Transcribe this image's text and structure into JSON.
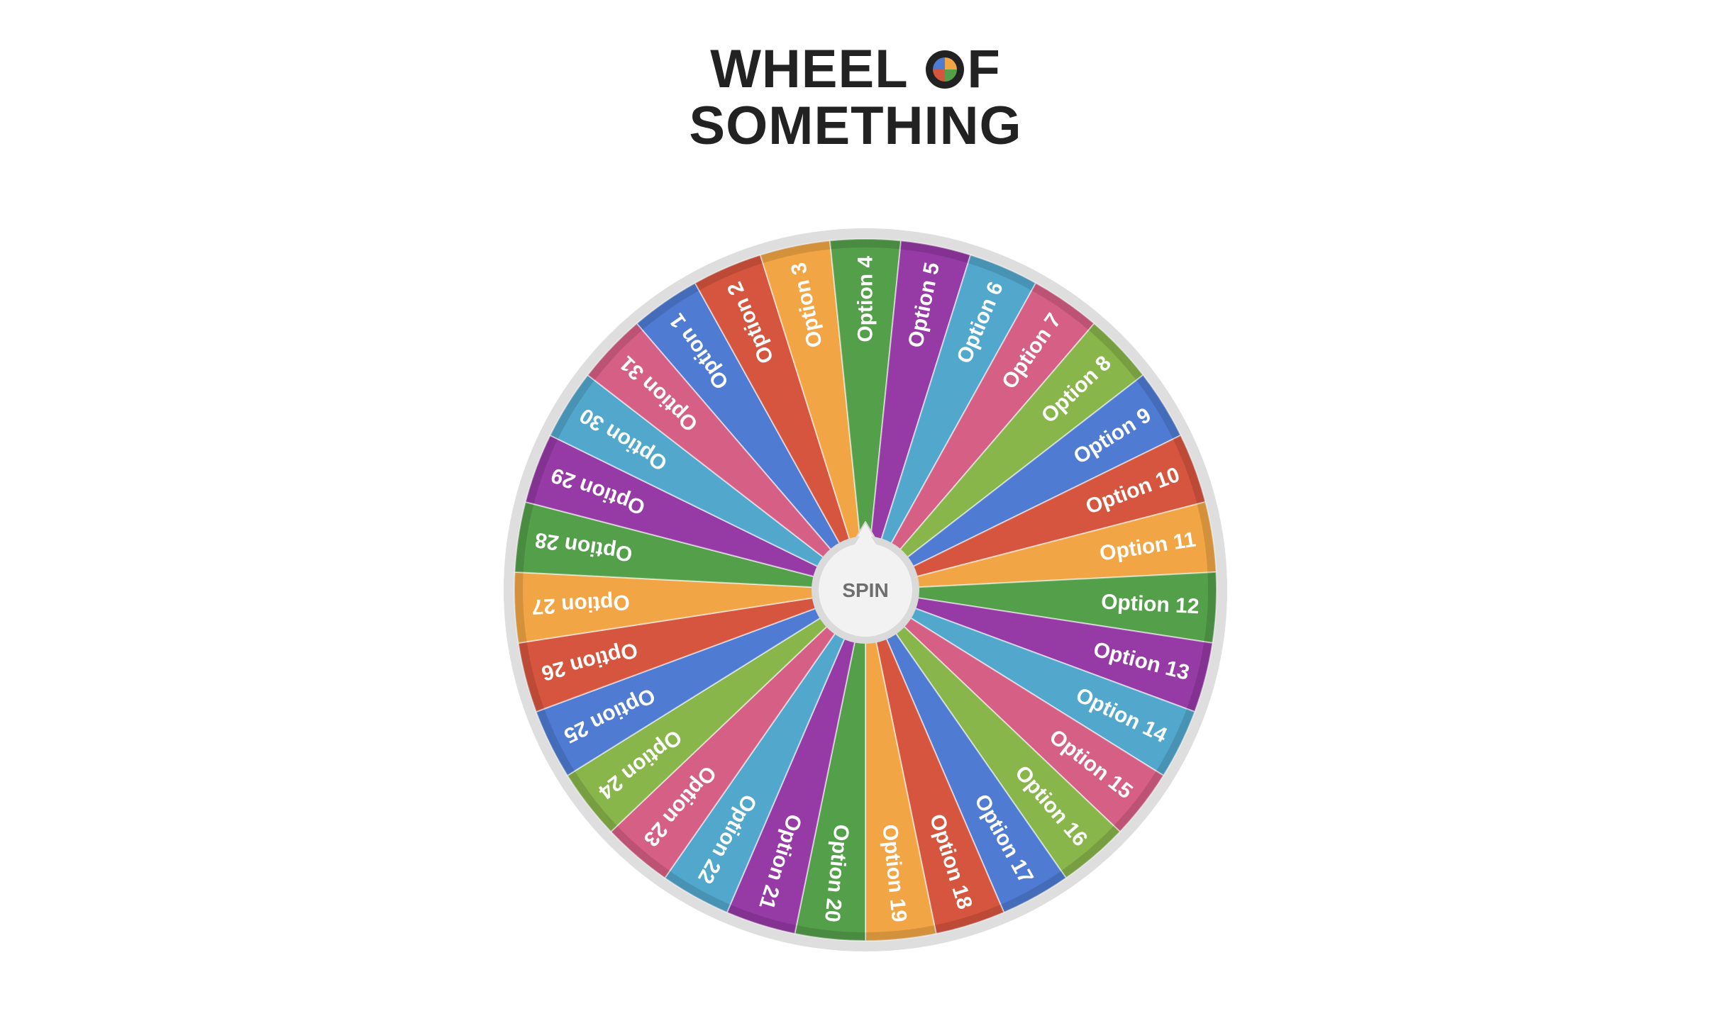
{
  "logo": {
    "line1_a": "WHEEL",
    "line1_b": "F",
    "line2": "SOMETHING",
    "icon": "pie-logo-icon",
    "icon_colors": [
      "#f2a544",
      "#4f7bd3",
      "#d6553e",
      "#54a04a"
    ]
  },
  "wheel": {
    "options": [
      "Option 1",
      "Option 2",
      "Option 3",
      "Option 4",
      "Option 5",
      "Option 6",
      "Option 7",
      "Option 8",
      "Option 9",
      "Option 10",
      "Option 11",
      "Option 12",
      "Option 13",
      "Option 14",
      "Option 15",
      "Option 16",
      "Option 17",
      "Option 18",
      "Option 19",
      "Option 20",
      "Option 21",
      "Option 22",
      "Option 23",
      "Option 24",
      "Option 25",
      "Option 26",
      "Option 27",
      "Option 28",
      "Option 29",
      "Option 30",
      "Option 31"
    ],
    "colors": {
      "Option 1": "#4f7bd3",
      "Option 2": "#d6553e",
      "Option 3": "#f2a544",
      "Option 4": "#54a04a",
      "Option 5": "#963aa5",
      "Option 6": "#52a8cc",
      "Option 7": "#d65f86",
      "Option 8": "#88b64a",
      "Option 9": "#4f7bd3",
      "Option 10": "#d6553e",
      "Option 11": "#f2a544",
      "Option 12": "#54a04a",
      "Option 13": "#963aa5",
      "Option 14": "#52a8cc",
      "Option 15": "#d65f86",
      "Option 16": "#88b64a",
      "Option 17": "#4f7bd3",
      "Option 18": "#d6553e",
      "Option 19": "#f2a544",
      "Option 20": "#54a04a",
      "Option 21": "#963aa5",
      "Option 22": "#52a8cc",
      "Option 23": "#d65f86",
      "Option 24": "#88b64a",
      "Option 25": "#4f7bd3",
      "Option 26": "#d6553e",
      "Option 27": "#f2a544",
      "Option 28": "#54a04a",
      "Option 29": "#963aa5",
      "Option 30": "#52a8cc",
      "Option 31": "#d65f86"
    },
    "rim_color": "#dedede",
    "label_color": "#ffffff"
  },
  "spin_button": {
    "label": "SPIN"
  }
}
